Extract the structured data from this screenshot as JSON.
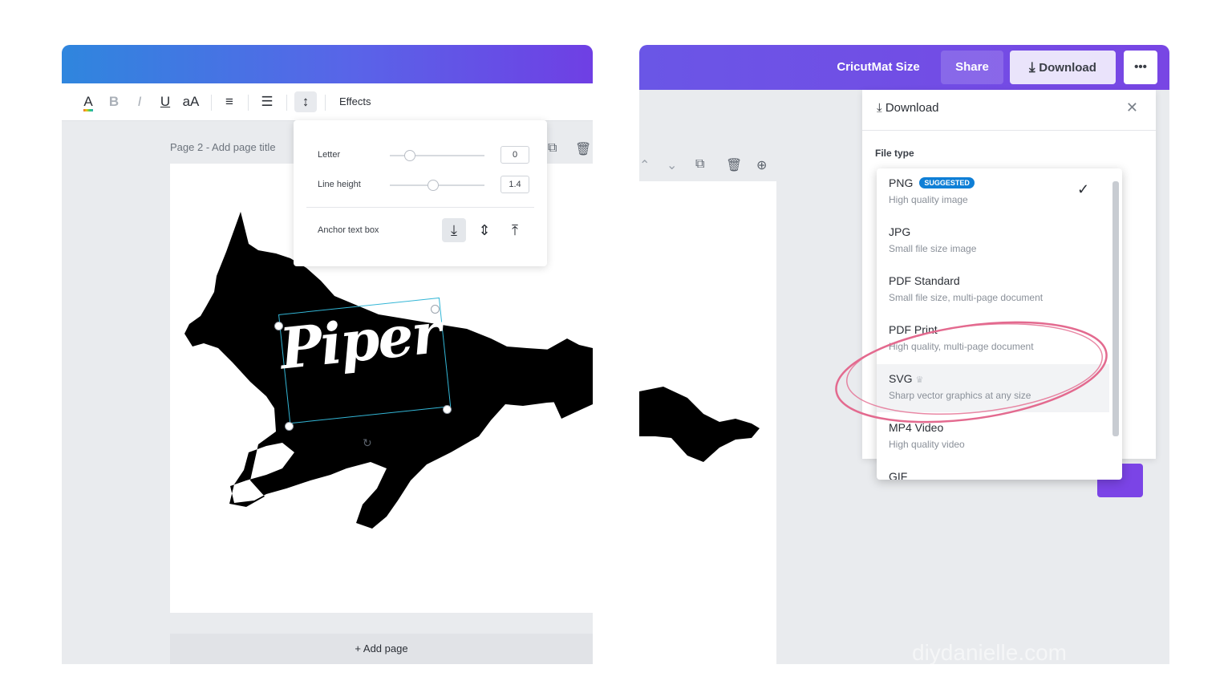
{
  "left_editor": {
    "toolbar": {
      "text_color": "A",
      "bold": "B",
      "italic": "I",
      "underline": "U",
      "case": "aA",
      "align": "≡",
      "list": "☰",
      "spacing": "↕",
      "effects": "Effects"
    },
    "spacing_popup": {
      "letter_label": "Letter",
      "letter_value": "0",
      "line_height_label": "Line height",
      "line_height_value": "1.4",
      "anchor_label": "Anchor text box",
      "letter_level": 0.2,
      "line_height_level": 0.45
    },
    "page_title": "Page 2 - Add page title",
    "design_text": "Piper",
    "add_page": "+ Add page"
  },
  "right_editor": {
    "topbar": {
      "title": "CricutMat Size",
      "share": "Share",
      "download": "Download",
      "more": "•••"
    },
    "download_panel": {
      "title": "Download",
      "file_type_label": "File type",
      "options": [
        {
          "name": "PNG",
          "badge": "SUGGESTED",
          "desc": "High quality image",
          "selected": true
        },
        {
          "name": "JPG",
          "desc": "Small file size image"
        },
        {
          "name": "PDF Standard",
          "desc": "Small file size, multi-page document"
        },
        {
          "name": "PDF Print",
          "desc": "High quality, multi-page document"
        },
        {
          "name": "SVG",
          "desc": "Sharp vector graphics at any size"
        },
        {
          "name": "MP4 Video",
          "desc": "High quality video"
        },
        {
          "name": "GIF",
          "desc": ""
        }
      ]
    },
    "watermark": "diydanielle.com"
  },
  "colors": {
    "gradient_start": "#2f86de",
    "gradient_end": "#6f3fe4",
    "purple": "#7b44e6",
    "suggested_badge": "#0f7fd6",
    "annotation_circle": "#e36a8f",
    "selection_outline": "#33b6d6"
  },
  "icons": {
    "close": "close-icon",
    "check": "check-icon",
    "download": "download-icon",
    "copy": "copy-icon",
    "trash": "trash-icon"
  }
}
